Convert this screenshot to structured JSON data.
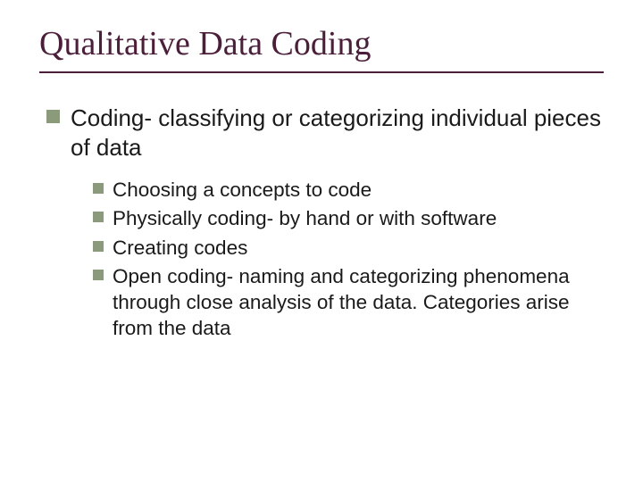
{
  "slide": {
    "title": "Qualitative Data Coding",
    "bullets": [
      {
        "text": "Coding- classifying or categorizing individual pieces of data",
        "children": [
          "Choosing a concepts to code",
          "Physically coding- by hand or with software",
          "Creating codes",
          "Open coding- naming and categorizing phenomena through close analysis of the data. Categories arise from the data"
        ]
      }
    ]
  }
}
